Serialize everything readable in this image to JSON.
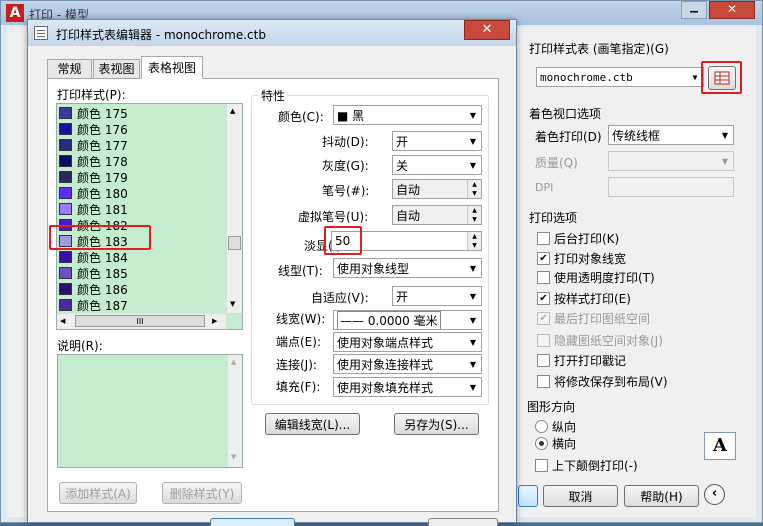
{
  "parent": {
    "title": "打印 - 模型",
    "plot_style_group": "打印样式表 (画笔指定)(G)",
    "plot_style_value": "monochrome.ctb",
    "shaded_group": "着色视口选项",
    "shaded_label": "着色打印(D)",
    "shaded_value": "传统线框",
    "quality_label": "质量(Q)",
    "dpi_label": "DPI",
    "options_group": "打印选项",
    "options": [
      {
        "label": "后台打印(K)",
        "checked": false,
        "disabled": false
      },
      {
        "label": "打印对象线宽",
        "checked": true,
        "disabled": false
      },
      {
        "label": "使用透明度打印(T)",
        "checked": false,
        "disabled": false
      },
      {
        "label": "按样式打印(E)",
        "checked": true,
        "disabled": false
      },
      {
        "label": "最后打印图纸空间",
        "checked": true,
        "disabled": true
      },
      {
        "label": "隐藏图纸空间对象(J)",
        "checked": false,
        "disabled": true
      },
      {
        "label": "打开打印戳记",
        "checked": false,
        "disabled": false
      },
      {
        "label": "将修改保存到布局(V)",
        "checked": false,
        "disabled": false
      }
    ],
    "orient_group": "图形方向",
    "portrait": "纵向",
    "landscape": "横向",
    "upside_down": "上下颠倒打印(-)",
    "cancel": "取消",
    "help": "帮助(H)",
    "orient_glyph": "A"
  },
  "editor": {
    "title": "打印样式表编辑器 - monochrome.ctb",
    "tabs": [
      "常规",
      "表视图",
      "表格视图"
    ],
    "styles_label": "打印样式(P):",
    "styles": [
      {
        "name": "颜色 175",
        "color": "#3a3a9a"
      },
      {
        "name": "颜色 176",
        "color": "#1a10a0"
      },
      {
        "name": "颜色 177",
        "color": "#2a2a7a"
      },
      {
        "name": "颜色 178",
        "color": "#0c0c60"
      },
      {
        "name": "颜色 179",
        "color": "#2a2a5a"
      },
      {
        "name": "颜色 180",
        "color": "#5a2aff"
      },
      {
        "name": "颜色 181",
        "color": "#9a7aff"
      },
      {
        "name": "颜色 182",
        "color": "#4a1ad0"
      },
      {
        "name": "颜色 183",
        "color": "#a09ae0"
      },
      {
        "name": "颜色 184",
        "color": "#3a10a0"
      },
      {
        "name": "颜色 185",
        "color": "#6a50c0"
      },
      {
        "name": "颜色 186",
        "color": "#2a106a"
      },
      {
        "name": "颜色 187",
        "color": "#4a2a9a"
      }
    ],
    "desc_label": "说明(R):",
    "add_style": "添加样式(A)",
    "delete_style": "删除样式(Y)",
    "props_group": "特性",
    "color_label": "颜色(C):",
    "color_value": "■ 黑",
    "dither_label": "抖动(D):",
    "dither_value": "开",
    "gray_label": "灰度(G):",
    "gray_value": "关",
    "pen_label": "笔号(#):",
    "pen_value": "自动",
    "vpen_label": "虚拟笔号(U):",
    "vpen_value": "自动",
    "screen_label": "淡显(I):",
    "screen_value": "50",
    "linetype_label": "线型(T):",
    "linetype_value": "使用对象线型",
    "adaptive_label": "自适应(V):",
    "adaptive_value": "开",
    "lineweight_label": "线宽(W):",
    "lineweight_value": "—— 0.0000 毫米",
    "endstyle_label": "端点(E):",
    "endstyle_value": "使用对象端点样式",
    "joinstyle_label": "连接(J):",
    "joinstyle_value": "使用对象连接样式",
    "fill_label": "填充(F):",
    "fill_value": "使用对象填充样式",
    "edit_lw": "编辑线宽(L)...",
    "save_as": "另存为(S)...",
    "scroll_glyph": "III"
  },
  "colors": {
    "list_bg": "#c6ecd0",
    "highlight": "#e02020",
    "desktop": "#4a6d8c"
  }
}
